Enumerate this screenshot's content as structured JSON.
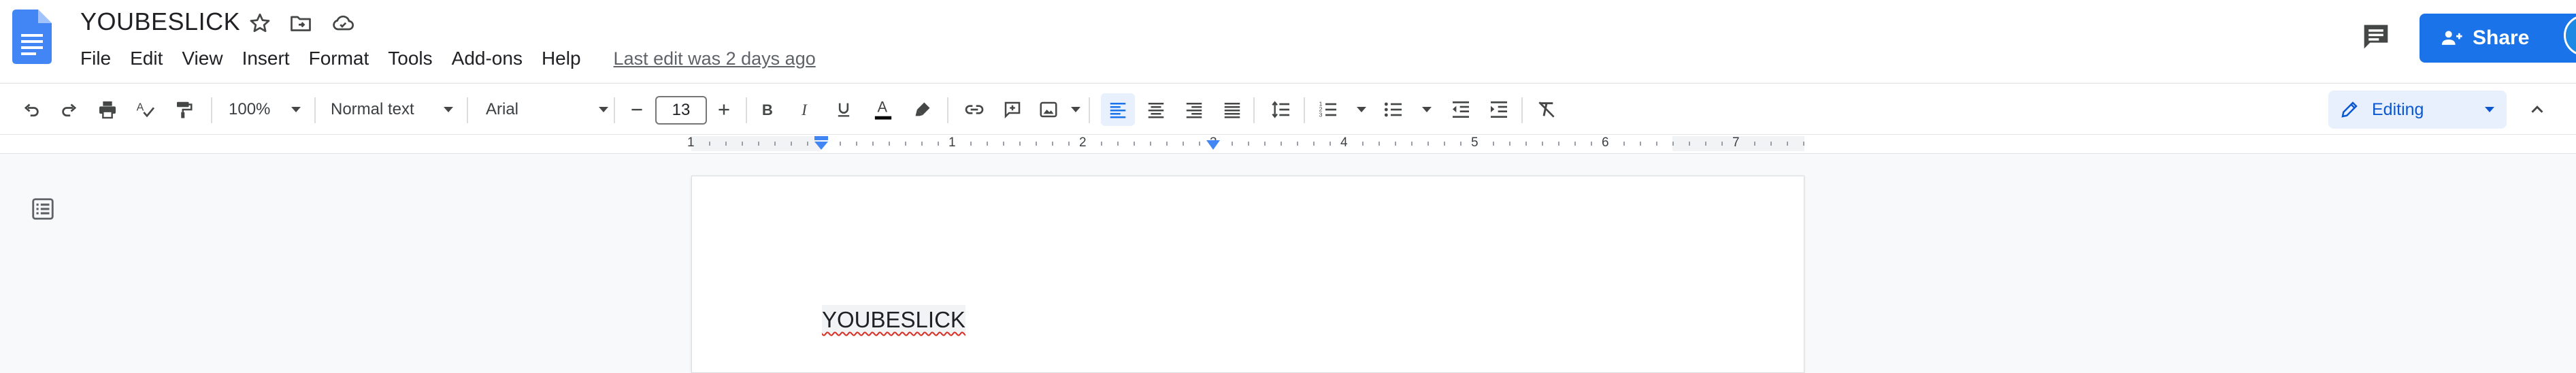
{
  "header": {
    "title": "YOUBESLICK",
    "icons": [
      "star-icon",
      "move-to-folder-icon",
      "cloud-saved-icon"
    ],
    "menu": [
      "File",
      "Edit",
      "View",
      "Insert",
      "Format",
      "Tools",
      "Add-ons",
      "Help"
    ],
    "last_edit": "Last edit was 2 days ago",
    "share_label": "Share",
    "brand_color": "#1a73e8"
  },
  "toolbar": {
    "zoom": "100%",
    "style": "Normal text",
    "font": "Arial",
    "font_size": "13",
    "mode": "Editing",
    "icons": [
      "undo-icon",
      "redo-icon",
      "print-icon",
      "spellcheck-icon",
      "paint-format-icon",
      "bold-icon",
      "italic-icon",
      "underline-icon",
      "text-color-icon",
      "highlight-icon",
      "link-icon",
      "add-comment-icon",
      "insert-image-icon",
      "align-left-icon",
      "align-center-icon",
      "align-right-icon",
      "justify-icon",
      "line-spacing-icon",
      "numbered-list-icon",
      "bulleted-list-icon",
      "decrease-indent-icon",
      "increase-indent-icon",
      "clear-formatting-icon"
    ]
  },
  "ruler": {
    "numbers": [
      "1",
      "1",
      "2",
      "3",
      "4",
      "5",
      "6",
      "7"
    ]
  },
  "document": {
    "text": "YOUBESLICK"
  }
}
